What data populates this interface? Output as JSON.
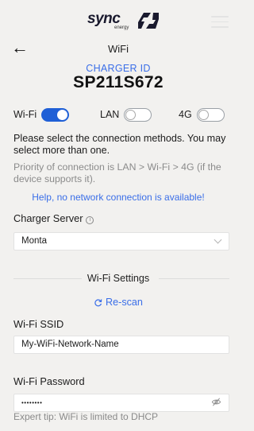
{
  "header": {
    "logo_text": "sync",
    "logo_sub": "energy",
    "page_title": "WiFi"
  },
  "charger": {
    "id_label": "CHARGER ID",
    "id_value": "SP211S672"
  },
  "connection": {
    "toggles": [
      {
        "label": "Wi-Fi",
        "state": "on"
      },
      {
        "label": "LAN",
        "state": "off"
      },
      {
        "label": "4G",
        "state": "off"
      }
    ],
    "instructions": "Please select the connection methods. You may select more than one.",
    "priority_note": "Priority of connection is LAN > Wi-Fi > 4G (if the device supports it).",
    "warning": "Help, no network connection is available!"
  },
  "charger_server": {
    "label": "Charger Server",
    "selected": "Monta"
  },
  "wifi_settings": {
    "title": "Wi-Fi Settings",
    "rescan_label": "Re-scan",
    "ssid_label": "Wi-Fi SSID",
    "ssid_value": "My-WiFi-Network-Name",
    "password_label": "Wi-Fi Password",
    "password_value": "••••••••",
    "expert_tip": "Expert tip: WiFi is limited to DHCP"
  },
  "colors": {
    "accent": "#3a6ee8",
    "toggle_on": "#1f5fd6",
    "background": "#f2f1ef"
  }
}
